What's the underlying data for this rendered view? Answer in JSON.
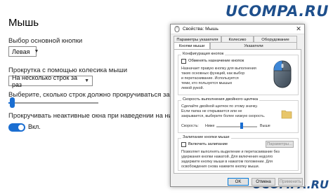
{
  "watermark": {
    "top": "UCOMPA.RU",
    "bottom": "UCOMPA.RU"
  },
  "settings": {
    "title": "Мышь",
    "primary_button": {
      "label": "Выбор основной кнопки",
      "value": "Левая"
    },
    "scroll_mode": {
      "label": "Прокрутка с помощью колесика мыши",
      "value": "На несколько строк за раз"
    },
    "lines_label": "Выберите, сколько строк должно прокручиваться за один раз",
    "lines_value": 0.04,
    "inactive_scroll": {
      "label": "Прокручивать неактивные окна при наведении на них",
      "toggle_label": "Вкл.",
      "state": true
    }
  },
  "dialog": {
    "title": "Свойства: Мышь",
    "tabs_top": [
      "Параметры указателя",
      "Колесико",
      "Оборудование"
    ],
    "tabs_bottom": [
      "Кнопки мыши",
      "Указатели"
    ],
    "active_tab": "Кнопки мыши",
    "config": {
      "title": "Конфигурация кнопок",
      "checkbox_label": "Обменять назначение кнопок",
      "checked": false,
      "description": [
        "Назначает правую кнопку для выполнения",
        "таких основных функций, как выбор",
        "и перетаскивание. Используется",
        "теми, кто пользуется мышью",
        "левой рукой."
      ]
    },
    "double_click": {
      "title": "Скорость выполнения двойного щелчка",
      "description": [
        "Сделайте двойной щелчок по этому значку.",
        "Если папка не открывается или не",
        "закрывается, выберите более низкую скорость."
      ],
      "speed_label": "Скорость:",
      "low": "Ниже",
      "high": "Выше",
      "speed_value": 0.62
    },
    "click_lock": {
      "title": "Залипание кнопки мыши",
      "checkbox_label": "Включить залипание",
      "checked": false,
      "params_button": "Параметры...",
      "description": [
        "Позволяет выполнять выделение и перетаскивание без",
        "удержания кнопки нажатой. Для включения недолго",
        "задержите кнопку мыши в нажатом положении. Для",
        "освобождения снова нажмите кнопку мыши."
      ]
    },
    "buttons": {
      "ok": "OK",
      "cancel": "Отмена",
      "apply": "Применить"
    }
  },
  "colors": {
    "accent": "#1b6ed1",
    "watermark": "#1e4f8c",
    "folder": "#e8c66a"
  },
  "icons": [
    "mouse-icon",
    "close-icon",
    "chevron-down-icon",
    "folder-icon",
    "dialog-mouse-icon"
  ]
}
